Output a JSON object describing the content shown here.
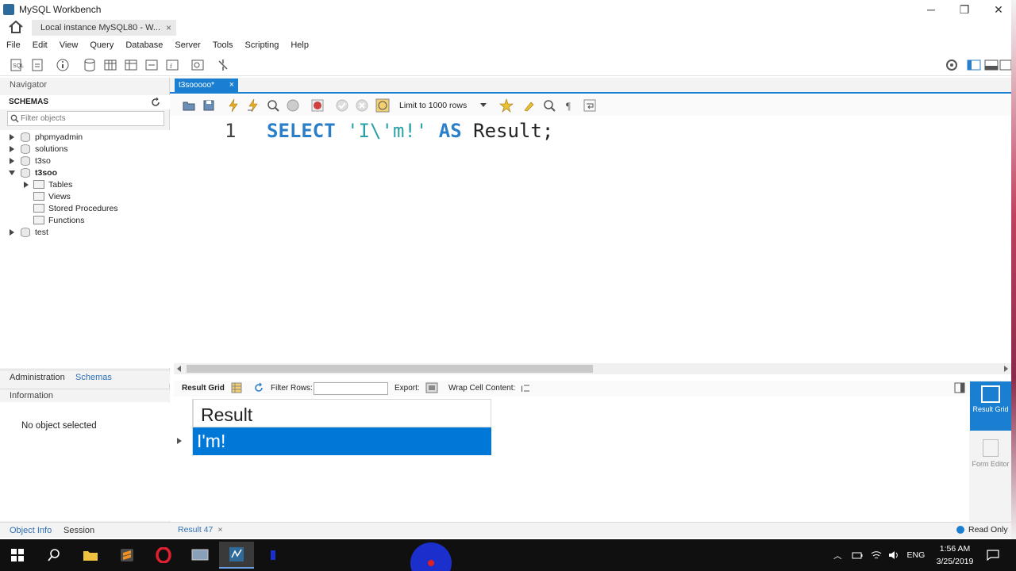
{
  "window": {
    "title": "MySQL Workbench",
    "min": "─",
    "restore": "❐",
    "close": "✕"
  },
  "connection_tab": {
    "label": "Local instance MySQL80 - W...",
    "close": "×"
  },
  "menu": [
    "File",
    "Edit",
    "View",
    "Query",
    "Database",
    "Server",
    "Tools",
    "Scripting",
    "Help"
  ],
  "navigator": {
    "title": "Navigator",
    "schemas_label": "SCHEMAS",
    "filter_placeholder": "Filter objects",
    "schemas": [
      {
        "name": "phpmyadmin",
        "expanded": false
      },
      {
        "name": "solutions",
        "expanded": false
      },
      {
        "name": "t3so",
        "expanded": false
      },
      {
        "name": "t3soo",
        "expanded": true,
        "children": [
          "Tables",
          "Views",
          "Stored Procedures",
          "Functions"
        ]
      },
      {
        "name": "test",
        "expanded": false
      }
    ],
    "tab_admin": "Administration",
    "tab_schemas": "Schemas",
    "info_title": "Information",
    "no_object": "No object selected",
    "tab_object_info": "Object Info",
    "tab_session": "Session"
  },
  "editor": {
    "tab_label": "t3sooooo*",
    "tab_close": "×",
    "limit_label": "Limit to 1000 rows",
    "line_number": "1",
    "sql": {
      "kw1": "SELECT",
      "str": "'I\\'m!'",
      "kw2": "AS",
      "ident": "Result;"
    }
  },
  "result": {
    "grid_label": "Result Grid",
    "filter_rows_label": "Filter Rows:",
    "export_label": "Export:",
    "wrap_label": "Wrap Cell Content:",
    "column_header": "Result",
    "row_value": "I'm!",
    "side_result_grid": "Result Grid",
    "side_form_editor": "Form Editor",
    "tab_label": "Result 47",
    "tab_close": "×",
    "status": "Read Only"
  },
  "taskbar": {
    "lang": "ENG",
    "time": "1:56 AM",
    "date": "3/25/2019"
  },
  "colors": {
    "accent": "#1a7fd1",
    "selection": "#0078d7",
    "keyword": "#2a7fc9",
    "string": "#2aa0a8"
  }
}
